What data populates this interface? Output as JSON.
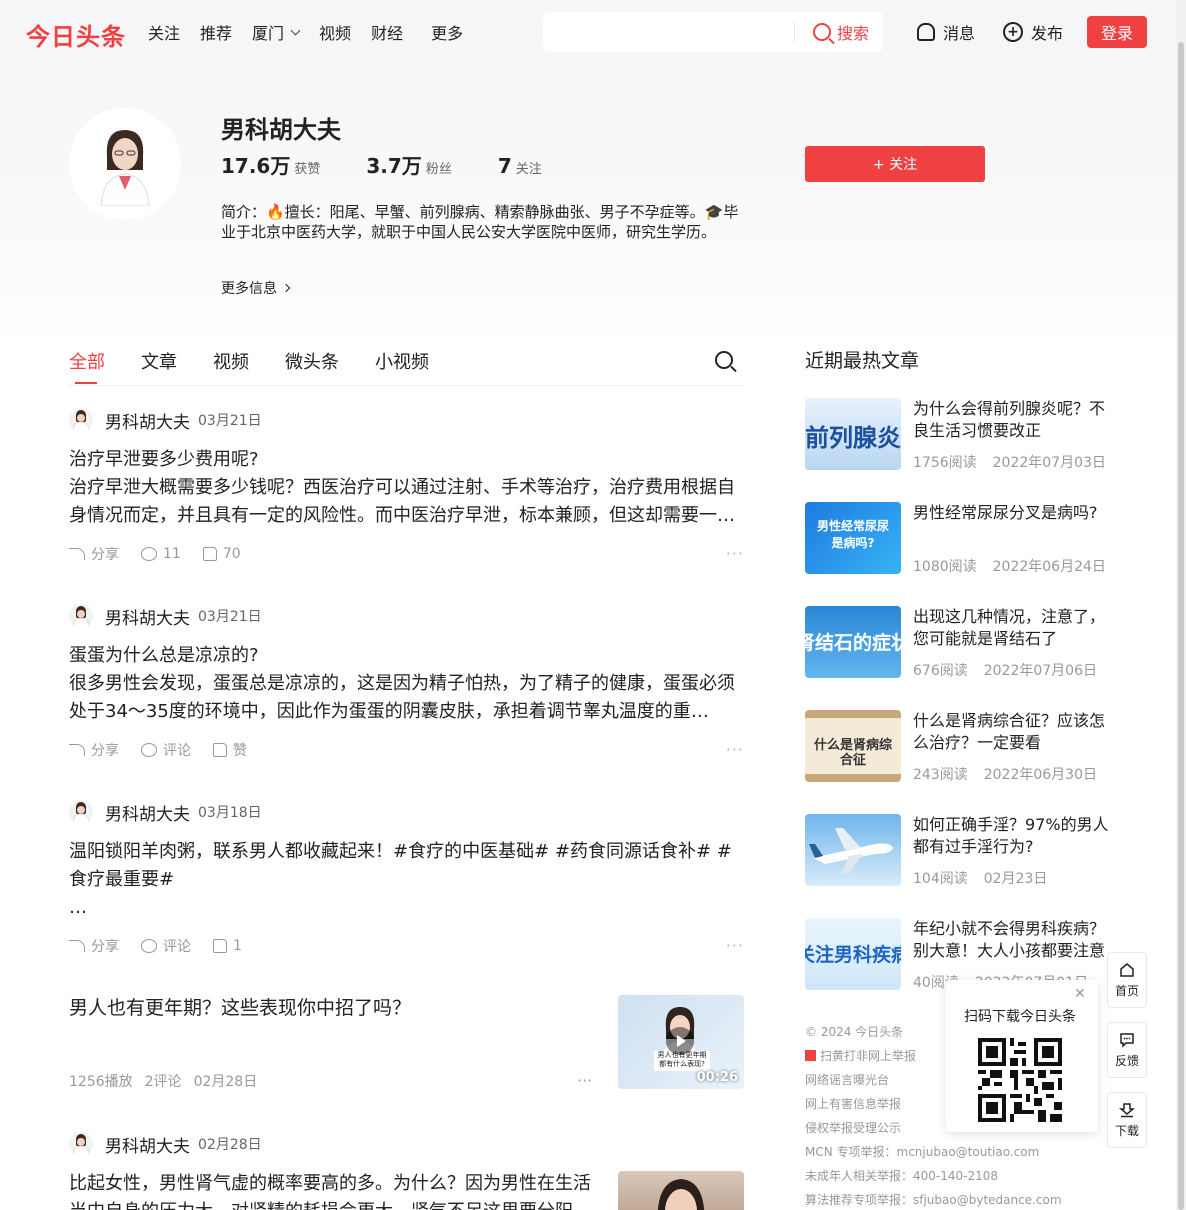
{
  "header": {
    "logo": "今日头条",
    "nav": [
      "关注",
      "推荐",
      "厦门",
      "视频",
      "财经",
      "更多"
    ],
    "search_placeholder": "",
    "search_label": "搜索",
    "messages_label": "消息",
    "publish_label": "发布",
    "login_label": "登录"
  },
  "profile": {
    "name": "男科胡大夫",
    "likes_num": "17.6万",
    "likes_label": "获赞",
    "fans_num": "3.7万",
    "fans_label": "粉丝",
    "following_num": "7",
    "following_label": "关注",
    "follow_button": "+ 关注",
    "bio": "简介：🔥擅长：阳尾、早蟹、前列腺病、精索静脉曲张、男子不孕症等。🎓毕业于北京中医药大学，就职于中国人民公安大学医院中医师，研究生学历。",
    "more_info": "更多信息"
  },
  "tabs": [
    "全部",
    "文章",
    "视频",
    "微头条",
    "小视频"
  ],
  "feed": [
    {
      "author": "男科胡大夫",
      "date": "03月21日",
      "title": "治疗早泄要多少费用呢?",
      "body": "治疗早泄大概需要多少钱呢？西医治疗可以通过注射、手术等治疗，治疗费用根据自身情况而定，并且具有一定的风险性。而中医治疗早泄，标本兼顾，但这却需要一定的时间。",
      "share": "分享",
      "comment": "11",
      "like": "70"
    },
    {
      "author": "男科胡大夫",
      "date": "03月21日",
      "title": "蛋蛋为什么总是凉凉的?",
      "body": "很多男性会发现，蛋蛋总是凉凉的，这是因为精子怕热，为了精子的健康，蛋蛋必须处于34～35度的环境中，因此作为蛋蛋的阴囊皮肤，承担着调节睾丸温度的重任。…",
      "share": "分享",
      "comment": "评论",
      "like": "赞"
    },
    {
      "author": "男科胡大夫",
      "date": "03月18日",
      "title": "温阳锁阳羊肉粥，联系男人都收藏起来！#食疗的中医基础# #药食同源话食补# #食疗最重要#",
      "body": "…",
      "share": "分享",
      "comment": "评论",
      "like": "1"
    }
  ],
  "video": {
    "title": "男人也有更年期？这些表现你中招了吗？",
    "plays": "1256播放",
    "comments": "2评论",
    "date": "02月28日",
    "duration": "00:26",
    "thumb_caption": "男人也有更年期 都有什么表现?"
  },
  "last_post": {
    "author": "男科胡大夫",
    "date": "02月28日",
    "body": "比起女性，男性肾气虚的概率要高的多。为什么？因为男性在生活当中自身的压力大，对肾精的耗损会更大，肾气不足这里要分阳"
  },
  "hot": {
    "title": "近期最热文章",
    "items": [
      {
        "title": "为什么会得前列腺炎呢？不良生活习惯要改正",
        "reads": "1756阅读",
        "date": "2022年07月03日",
        "thumb_text": "前列腺炎"
      },
      {
        "title": "男性经常尿尿分叉是病吗?",
        "reads": "1080阅读",
        "date": "2022年06月24日",
        "thumb_text": "男性经常尿尿是病吗?"
      },
      {
        "title": "出现这几种情况，注意了，您可能就是肾结石了",
        "reads": "676阅读",
        "date": "2022年07月06日",
        "thumb_text": "肾结石的症状"
      },
      {
        "title": "什么是肾病综合征？应该怎么治疗？一定要看",
        "reads": "243阅读",
        "date": "2022年06月30日",
        "thumb_text": "什么是肾病综合征"
      },
      {
        "title": "如何正确手淫？97%的男人都有过手淫行为?",
        "reads": "104阅读",
        "date": "02月23日",
        "thumb_text": ""
      },
      {
        "title": "年纪小就不会得男科疾病？别大意！大人小孩都要注意",
        "reads": "40阅读",
        "date": "2022年07月01日",
        "thumb_text": "关注男科疾病"
      }
    ]
  },
  "footer": [
    "© 2024 今日头条",
    "扫黄打非网上举报",
    "网络谣言曝光台",
    "网上有害信息举报",
    "侵权举报受理公示",
    "MCN 专项举报：mcnjubao@toutiao.com",
    "未成年人相关举报：400-140-2108",
    "算法推荐专项举报：sfjubao@bytedance.com"
  ],
  "qr": {
    "title": "扫码下载今日头条"
  },
  "side": {
    "home": "首页",
    "feedback": "反馈",
    "download": "下载"
  },
  "colors": {
    "brand": "#f04142"
  }
}
